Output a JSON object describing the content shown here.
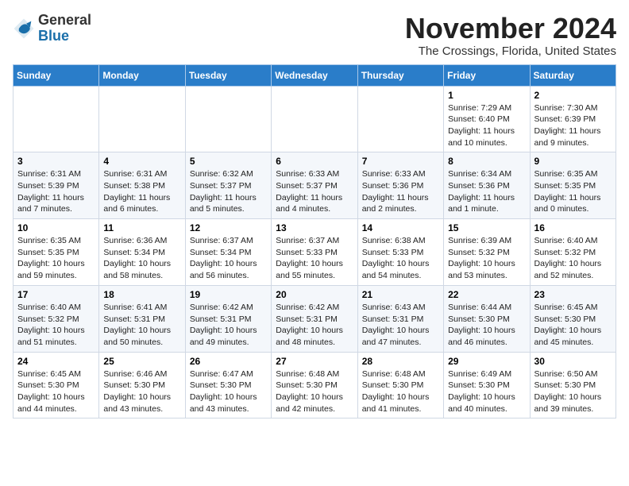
{
  "logo": {
    "general": "General",
    "blue": "Blue"
  },
  "header": {
    "month": "November 2024",
    "location": "The Crossings, Florida, United States"
  },
  "weekdays": [
    "Sunday",
    "Monday",
    "Tuesday",
    "Wednesday",
    "Thursday",
    "Friday",
    "Saturday"
  ],
  "weeks": [
    [
      {
        "day": "",
        "content": ""
      },
      {
        "day": "",
        "content": ""
      },
      {
        "day": "",
        "content": ""
      },
      {
        "day": "",
        "content": ""
      },
      {
        "day": "",
        "content": ""
      },
      {
        "day": "1",
        "content": "Sunrise: 7:29 AM\nSunset: 6:40 PM\nDaylight: 11 hours and 10 minutes."
      },
      {
        "day": "2",
        "content": "Sunrise: 7:30 AM\nSunset: 6:39 PM\nDaylight: 11 hours and 9 minutes."
      }
    ],
    [
      {
        "day": "3",
        "content": "Sunrise: 6:31 AM\nSunset: 5:39 PM\nDaylight: 11 hours and 7 minutes."
      },
      {
        "day": "4",
        "content": "Sunrise: 6:31 AM\nSunset: 5:38 PM\nDaylight: 11 hours and 6 minutes."
      },
      {
        "day": "5",
        "content": "Sunrise: 6:32 AM\nSunset: 5:37 PM\nDaylight: 11 hours and 5 minutes."
      },
      {
        "day": "6",
        "content": "Sunrise: 6:33 AM\nSunset: 5:37 PM\nDaylight: 11 hours and 4 minutes."
      },
      {
        "day": "7",
        "content": "Sunrise: 6:33 AM\nSunset: 5:36 PM\nDaylight: 11 hours and 2 minutes."
      },
      {
        "day": "8",
        "content": "Sunrise: 6:34 AM\nSunset: 5:36 PM\nDaylight: 11 hours and 1 minute."
      },
      {
        "day": "9",
        "content": "Sunrise: 6:35 AM\nSunset: 5:35 PM\nDaylight: 11 hours and 0 minutes."
      }
    ],
    [
      {
        "day": "10",
        "content": "Sunrise: 6:35 AM\nSunset: 5:35 PM\nDaylight: 10 hours and 59 minutes."
      },
      {
        "day": "11",
        "content": "Sunrise: 6:36 AM\nSunset: 5:34 PM\nDaylight: 10 hours and 58 minutes."
      },
      {
        "day": "12",
        "content": "Sunrise: 6:37 AM\nSunset: 5:34 PM\nDaylight: 10 hours and 56 minutes."
      },
      {
        "day": "13",
        "content": "Sunrise: 6:37 AM\nSunset: 5:33 PM\nDaylight: 10 hours and 55 minutes."
      },
      {
        "day": "14",
        "content": "Sunrise: 6:38 AM\nSunset: 5:33 PM\nDaylight: 10 hours and 54 minutes."
      },
      {
        "day": "15",
        "content": "Sunrise: 6:39 AM\nSunset: 5:32 PM\nDaylight: 10 hours and 53 minutes."
      },
      {
        "day": "16",
        "content": "Sunrise: 6:40 AM\nSunset: 5:32 PM\nDaylight: 10 hours and 52 minutes."
      }
    ],
    [
      {
        "day": "17",
        "content": "Sunrise: 6:40 AM\nSunset: 5:32 PM\nDaylight: 10 hours and 51 minutes."
      },
      {
        "day": "18",
        "content": "Sunrise: 6:41 AM\nSunset: 5:31 PM\nDaylight: 10 hours and 50 minutes."
      },
      {
        "day": "19",
        "content": "Sunrise: 6:42 AM\nSunset: 5:31 PM\nDaylight: 10 hours and 49 minutes."
      },
      {
        "day": "20",
        "content": "Sunrise: 6:42 AM\nSunset: 5:31 PM\nDaylight: 10 hours and 48 minutes."
      },
      {
        "day": "21",
        "content": "Sunrise: 6:43 AM\nSunset: 5:31 PM\nDaylight: 10 hours and 47 minutes."
      },
      {
        "day": "22",
        "content": "Sunrise: 6:44 AM\nSunset: 5:30 PM\nDaylight: 10 hours and 46 minutes."
      },
      {
        "day": "23",
        "content": "Sunrise: 6:45 AM\nSunset: 5:30 PM\nDaylight: 10 hours and 45 minutes."
      }
    ],
    [
      {
        "day": "24",
        "content": "Sunrise: 6:45 AM\nSunset: 5:30 PM\nDaylight: 10 hours and 44 minutes."
      },
      {
        "day": "25",
        "content": "Sunrise: 6:46 AM\nSunset: 5:30 PM\nDaylight: 10 hours and 43 minutes."
      },
      {
        "day": "26",
        "content": "Sunrise: 6:47 AM\nSunset: 5:30 PM\nDaylight: 10 hours and 43 minutes."
      },
      {
        "day": "27",
        "content": "Sunrise: 6:48 AM\nSunset: 5:30 PM\nDaylight: 10 hours and 42 minutes."
      },
      {
        "day": "28",
        "content": "Sunrise: 6:48 AM\nSunset: 5:30 PM\nDaylight: 10 hours and 41 minutes."
      },
      {
        "day": "29",
        "content": "Sunrise: 6:49 AM\nSunset: 5:30 PM\nDaylight: 10 hours and 40 minutes."
      },
      {
        "day": "30",
        "content": "Sunrise: 6:50 AM\nSunset: 5:30 PM\nDaylight: 10 hours and 39 minutes."
      }
    ]
  ]
}
